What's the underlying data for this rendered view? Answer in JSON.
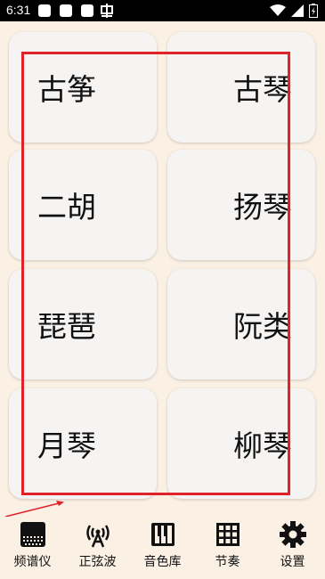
{
  "status_bar": {
    "time": "6:31",
    "notification_icons": [
      "square-icon",
      "square-icon",
      "square-icon",
      "app-icon"
    ],
    "right_icons": [
      "wifi-icon",
      "signal-icon",
      "battery-icon"
    ]
  },
  "instruments": [
    {
      "label": "古筝"
    },
    {
      "label": "古琴"
    },
    {
      "label": "二胡"
    },
    {
      "label": "扬琴"
    },
    {
      "label": "琵琶"
    },
    {
      "label": "阮类"
    },
    {
      "label": "月琴"
    },
    {
      "label": "柳琴"
    }
  ],
  "bottom_nav": [
    {
      "label": "频谱仪",
      "icon": "spectrum-icon"
    },
    {
      "label": "正弦波",
      "icon": "antenna-icon"
    },
    {
      "label": "音色库",
      "icon": "piano-icon"
    },
    {
      "label": "节奏",
      "icon": "grid-icon"
    },
    {
      "label": "设置",
      "icon": "gear-icon"
    }
  ],
  "colors": {
    "background": "#fbf0e4",
    "card": "#f6f4f2",
    "highlight": "#e0232a",
    "status_bar": "#000000"
  }
}
